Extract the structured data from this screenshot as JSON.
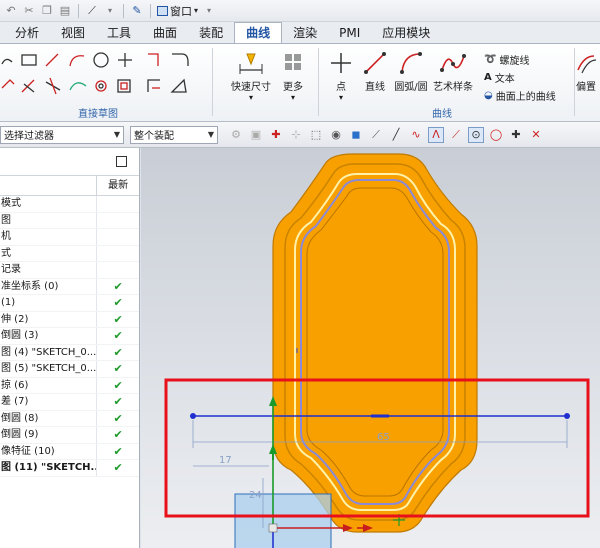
{
  "quick_access": {
    "window_label": "窗口"
  },
  "tabs": [
    {
      "label": "分析"
    },
    {
      "label": "视图"
    },
    {
      "label": "工具"
    },
    {
      "label": "曲面"
    },
    {
      "label": "装配"
    },
    {
      "label": "曲线"
    },
    {
      "label": "渲染"
    },
    {
      "label": "PMI"
    },
    {
      "label": "应用模块"
    }
  ],
  "active_tab": "曲线",
  "ribbon": {
    "direct_sketch_label": "直接草图",
    "quick_dimension_label": "快速尺寸",
    "more_label": "更多",
    "curve_group_label": "曲线",
    "point_label": "点",
    "line_label": "直线",
    "arc_circle_label": "圆弧/圆",
    "studio_spline_label": "艺术样条",
    "helix_label": "螺旋线",
    "text_label": "文本",
    "curve_on_surface_label": "曲面上的曲线",
    "offset_label": "偏置"
  },
  "filterbar": {
    "selection_filter": "选择过滤器",
    "assembly_scope": "整个装配"
  },
  "navigator": {
    "latest_header": "最新",
    "rows": [
      {
        "name": "模式",
        "check": ""
      },
      {
        "name": "图",
        "check": ""
      },
      {
        "name": "机",
        "check": ""
      },
      {
        "name": "式",
        "check": ""
      },
      {
        "name": "记录",
        "check": ""
      },
      {
        "name": "准坐标系 (0)",
        "check": "✔"
      },
      {
        "name": "(1)",
        "check": "✔"
      },
      {
        "name": "伸 (2)",
        "check": "✔"
      },
      {
        "name": "倒圆 (3)",
        "check": "✔"
      },
      {
        "name": "图 (4) \"SKETCH_0...",
        "check": "✔"
      },
      {
        "name": "图 (5) \"SKETCH_0...",
        "check": "✔"
      },
      {
        "name": "掠 (6)",
        "check": "✔"
      },
      {
        "name": "差 (7)",
        "check": "✔"
      },
      {
        "name": "倒圆 (8)",
        "check": "✔"
      },
      {
        "name": "倒圆 (9)",
        "check": "✔"
      },
      {
        "name": "像特征 (10)",
        "check": "✔"
      },
      {
        "name": "图 (11) \"SKETCH...",
        "check": "✔",
        "bold": true
      }
    ]
  },
  "graphics": {
    "dim_horizontal": "65",
    "dim_left": "17",
    "dim_vertical": "24",
    "model_color": "#f7a000",
    "highlight_color": "#e8101a",
    "sketch_color": "#1f2fd0"
  }
}
